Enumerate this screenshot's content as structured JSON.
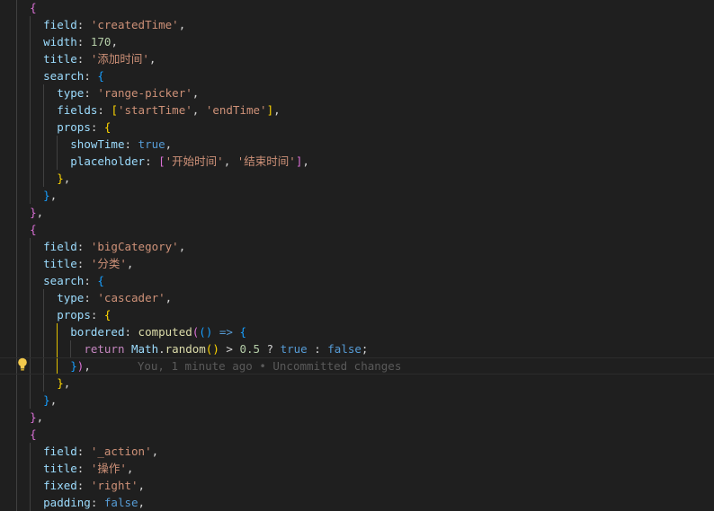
{
  "editor": {
    "blame": "You, 1 minute ago • Uncommitted changes",
    "blame_line": 21,
    "lines": [
      {
        "indent": 2,
        "tokens": [
          [
            "{",
            "b2"
          ]
        ]
      },
      {
        "indent": 3,
        "tokens": [
          [
            "field",
            "prop"
          ],
          [
            ": ",
            "p"
          ],
          [
            "'createdTime'",
            "str"
          ],
          [
            ",",
            "p"
          ]
        ]
      },
      {
        "indent": 3,
        "tokens": [
          [
            "width",
            "prop"
          ],
          [
            ": ",
            "p"
          ],
          [
            "170",
            "num"
          ],
          [
            ",",
            "p"
          ]
        ]
      },
      {
        "indent": 3,
        "tokens": [
          [
            "title",
            "prop"
          ],
          [
            ": ",
            "p"
          ],
          [
            "'添加时间'",
            "str"
          ],
          [
            ",",
            "p"
          ]
        ]
      },
      {
        "indent": 3,
        "tokens": [
          [
            "search",
            "prop"
          ],
          [
            ": ",
            "p"
          ],
          [
            "{",
            "b3"
          ]
        ]
      },
      {
        "indent": 4,
        "tokens": [
          [
            "type",
            "prop"
          ],
          [
            ": ",
            "p"
          ],
          [
            "'range-picker'",
            "str"
          ],
          [
            ",",
            "p"
          ]
        ]
      },
      {
        "indent": 4,
        "tokens": [
          [
            "fields",
            "prop"
          ],
          [
            ": ",
            "p"
          ],
          [
            "[",
            "b1"
          ],
          [
            "'startTime'",
            "str"
          ],
          [
            ", ",
            "p"
          ],
          [
            "'endTime'",
            "str"
          ],
          [
            "]",
            "b1"
          ],
          [
            ",",
            "p"
          ]
        ]
      },
      {
        "indent": 4,
        "tokens": [
          [
            "props",
            "prop"
          ],
          [
            ": ",
            "p"
          ],
          [
            "{",
            "b1"
          ]
        ]
      },
      {
        "indent": 5,
        "tokens": [
          [
            "showTime",
            "prop"
          ],
          [
            ": ",
            "p"
          ],
          [
            "true",
            "kw"
          ],
          [
            ",",
            "p"
          ]
        ]
      },
      {
        "indent": 5,
        "tokens": [
          [
            "placeholder",
            "prop"
          ],
          [
            ": ",
            "p"
          ],
          [
            "[",
            "b2"
          ],
          [
            "'开始时间'",
            "str"
          ],
          [
            ", ",
            "p"
          ],
          [
            "'结束时间'",
            "str"
          ],
          [
            "]",
            "b2"
          ],
          [
            ",",
            "p"
          ]
        ]
      },
      {
        "indent": 4,
        "tokens": [
          [
            "}",
            "b1"
          ],
          [
            ",",
            "p"
          ]
        ]
      },
      {
        "indent": 3,
        "tokens": [
          [
            "}",
            "b3"
          ],
          [
            ",",
            "p"
          ]
        ]
      },
      {
        "indent": 2,
        "tokens": [
          [
            "}",
            "b2"
          ],
          [
            ",",
            "p"
          ]
        ]
      },
      {
        "indent": 2,
        "tokens": [
          [
            "{",
            "b2"
          ]
        ]
      },
      {
        "indent": 3,
        "tokens": [
          [
            "field",
            "prop"
          ],
          [
            ": ",
            "p"
          ],
          [
            "'bigCategory'",
            "str"
          ],
          [
            ",",
            "p"
          ]
        ]
      },
      {
        "indent": 3,
        "tokens": [
          [
            "title",
            "prop"
          ],
          [
            ": ",
            "p"
          ],
          [
            "'分类'",
            "str"
          ],
          [
            ",",
            "p"
          ]
        ]
      },
      {
        "indent": 3,
        "tokens": [
          [
            "search",
            "prop"
          ],
          [
            ": ",
            "p"
          ],
          [
            "{",
            "b3"
          ]
        ]
      },
      {
        "indent": 4,
        "tokens": [
          [
            "type",
            "prop"
          ],
          [
            ": ",
            "p"
          ],
          [
            "'cascader'",
            "str"
          ],
          [
            ",",
            "p"
          ]
        ]
      },
      {
        "indent": 4,
        "tokens": [
          [
            "props",
            "prop"
          ],
          [
            ": ",
            "p"
          ],
          [
            "{",
            "b1"
          ]
        ]
      },
      {
        "indent": 5,
        "tokens": [
          [
            "bordered",
            "prop"
          ],
          [
            ": ",
            "p"
          ],
          [
            "computed",
            "fn"
          ],
          [
            "(",
            "b2"
          ],
          [
            "()",
            "b3"
          ],
          [
            " => ",
            "kw"
          ],
          [
            "{",
            "b3"
          ]
        ]
      },
      {
        "indent": 6,
        "tokens": [
          [
            "return",
            "ctl"
          ],
          [
            " ",
            "p"
          ],
          [
            "Math",
            "cls"
          ],
          [
            ".",
            "p"
          ],
          [
            "random",
            "fn"
          ],
          [
            "()",
            "b1"
          ],
          [
            " > ",
            "p"
          ],
          [
            "0.5",
            "num"
          ],
          [
            " ? ",
            "p"
          ],
          [
            "true",
            "kw"
          ],
          [
            " : ",
            "p"
          ],
          [
            "false",
            "kw"
          ],
          [
            ";",
            "p"
          ]
        ]
      },
      {
        "indent": 5,
        "tokens": [
          [
            "}",
            "b3"
          ],
          [
            ")",
            "b2"
          ],
          [
            ",",
            "p"
          ]
        ]
      },
      {
        "indent": 4,
        "tokens": [
          [
            "}",
            "b1"
          ],
          [
            ",",
            "p"
          ]
        ]
      },
      {
        "indent": 3,
        "tokens": [
          [
            "}",
            "b3"
          ],
          [
            ",",
            "p"
          ]
        ]
      },
      {
        "indent": 2,
        "tokens": [
          [
            "}",
            "b2"
          ],
          [
            ",",
            "p"
          ]
        ]
      },
      {
        "indent": 2,
        "tokens": [
          [
            "{",
            "b2"
          ]
        ]
      },
      {
        "indent": 3,
        "tokens": [
          [
            "field",
            "prop"
          ],
          [
            ": ",
            "p"
          ],
          [
            "'_action'",
            "str"
          ],
          [
            ",",
            "p"
          ]
        ]
      },
      {
        "indent": 3,
        "tokens": [
          [
            "title",
            "prop"
          ],
          [
            ": ",
            "p"
          ],
          [
            "'操作'",
            "str"
          ],
          [
            ",",
            "p"
          ]
        ]
      },
      {
        "indent": 3,
        "tokens": [
          [
            "fixed",
            "prop"
          ],
          [
            ": ",
            "p"
          ],
          [
            "'right'",
            "str"
          ],
          [
            ",",
            "p"
          ]
        ]
      },
      {
        "indent": 3,
        "tokens": [
          [
            "padding",
            "prop"
          ],
          [
            ": ",
            "p"
          ],
          [
            "false",
            "kw"
          ],
          [
            ",",
            "p"
          ]
        ]
      }
    ]
  }
}
